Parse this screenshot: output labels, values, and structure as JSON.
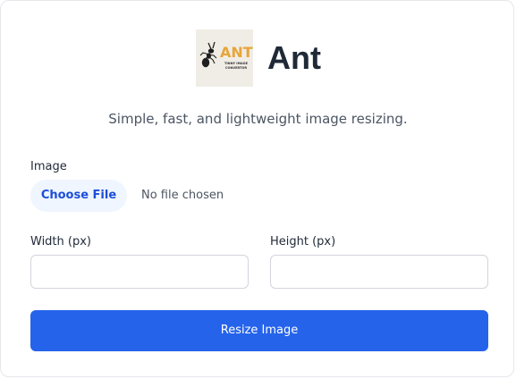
{
  "app": {
    "name": "Ant",
    "tagline": "Simple, fast, and lightweight image resizing.",
    "logo": {
      "icon": "ant-icon",
      "text": "ANT",
      "subtext": "TINNY IMAGE CONVERTOR"
    }
  },
  "form": {
    "image": {
      "label": "Image",
      "button_label": "Choose File",
      "status": "No file chosen"
    },
    "width": {
      "label": "Width (px)",
      "value": "",
      "placeholder": ""
    },
    "height": {
      "label": "Height (px)",
      "value": "",
      "placeholder": ""
    },
    "submit_label": "Resize Image"
  },
  "colors": {
    "primary": "#2563eb",
    "file_button_bg": "#eff6ff",
    "file_button_text": "#1d4ed8",
    "logo_accent": "#e8a53a",
    "logo_bg": "#f0ede6"
  }
}
